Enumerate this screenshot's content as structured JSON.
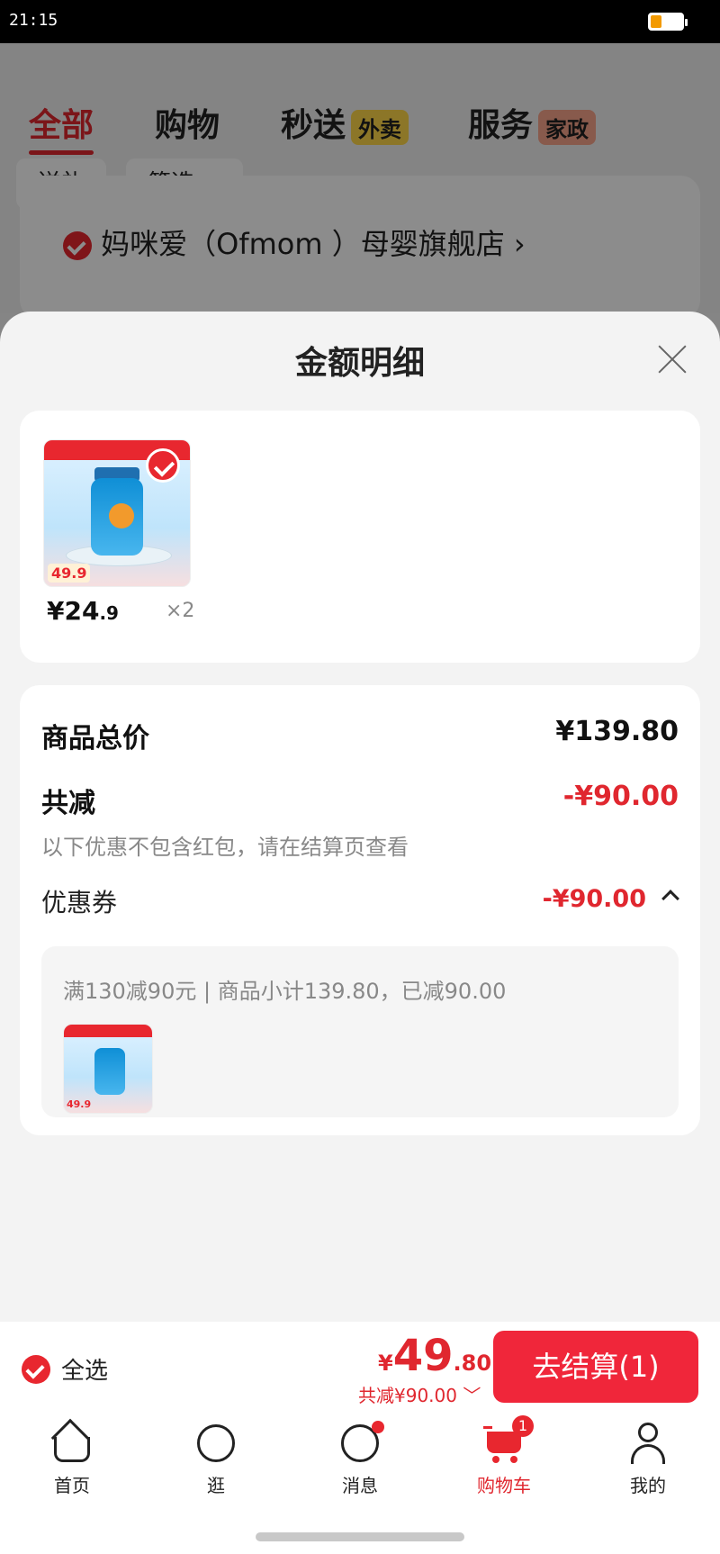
{
  "status_bar": {
    "time": "21:15"
  },
  "background_page": {
    "tabs": [
      {
        "label": "全部"
      },
      {
        "label": "购物"
      },
      {
        "label": "秒送",
        "tag": "外卖"
      },
      {
        "label": "服务",
        "tag": "家政"
      }
    ],
    "chips": [
      "送礼",
      "筛选"
    ],
    "store_name": "妈咪爱（Ofmom ）母婴旗舰店"
  },
  "sheet": {
    "title": "金额明细",
    "product": {
      "price_int": "¥24",
      "price_dec": ".9",
      "qty": "×2",
      "image_badge": "49.9"
    },
    "rows": {
      "total_label": "商品总价",
      "total_value": "¥139.80",
      "reduce_label": "共减",
      "reduce_value": "-¥90.00",
      "note": "以下优惠不包含红包，请在结算页查看",
      "coupon_label": "优惠券",
      "coupon_value": "-¥90.00"
    },
    "coupon_detail": "满130减90元 | 商品小计139.80，已减90.00"
  },
  "checkout": {
    "select_all": "全选",
    "currency": "¥",
    "amount_int": "49",
    "amount_dec": ".80",
    "reduce_text": "共减¥90.00",
    "button": "去结算(1)"
  },
  "tabbar": {
    "items": [
      {
        "label": "首页",
        "icon": "home-icon"
      },
      {
        "label": "逛",
        "icon": "face-icon"
      },
      {
        "label": "消息",
        "icon": "message-icon"
      },
      {
        "label": "购物车",
        "icon": "cart-icon",
        "badge": "1"
      },
      {
        "label": "我的",
        "icon": "user-icon"
      }
    ]
  },
  "colors": {
    "accent": "#e0272f",
    "button": "#f0263a"
  }
}
